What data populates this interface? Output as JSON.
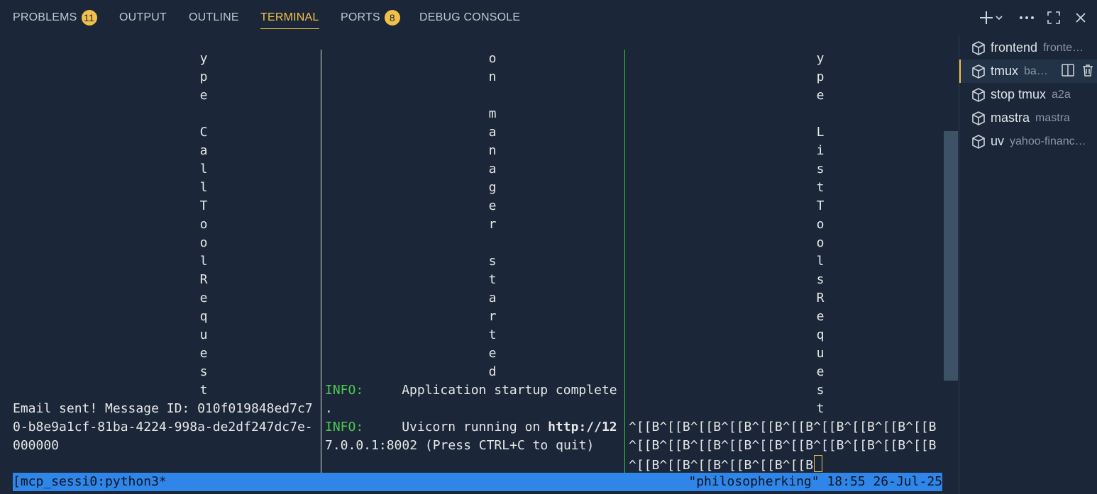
{
  "tabs": [
    {
      "label": "PROBLEMS",
      "badge": "11"
    },
    {
      "label": "OUTPUT"
    },
    {
      "label": "OUTLINE"
    },
    {
      "label": "TERMINAL",
      "active": true
    },
    {
      "label": "PORTS",
      "badge": "8"
    },
    {
      "label": "DEBUG CONSOLE"
    }
  ],
  "header_icons": [
    "new-terminal-icon",
    "chevron-down-icon",
    "more-actions-icon",
    "maximize-icon",
    "close-icon"
  ],
  "terminal": {
    "pane1": {
      "vertical_top": [
        "y",
        "p",
        "e",
        "",
        "C",
        "a",
        "l",
        "l",
        "T",
        "o",
        "o",
        "l",
        "R",
        "e",
        "q",
        "u",
        "e",
        "s",
        "t"
      ],
      "lines": [
        "Email sent! Message ID: 010f019848ed7c7",
        "0-b8e9a1cf-81ba-4224-998a-de2df247dc7e-",
        "000000"
      ]
    },
    "pane2": {
      "vertical_top": [
        "o",
        "n",
        "",
        "m",
        "a",
        "n",
        "a",
        "g",
        "e",
        "r",
        "",
        "s",
        "t",
        "a",
        "r",
        "t",
        "e",
        "d"
      ],
      "info_label": "INFO:",
      "msg1": "Application startup complete",
      "msg1_wrap": ".",
      "msg2_pre": "Uvicorn running on ",
      "msg2_url": "http://12",
      "msg2_wrap": "7.0.0.1:8002 (Press CTRL+C to quit)"
    },
    "pane3": {
      "vertical_top": [
        "y",
        "p",
        "e",
        "",
        "L",
        "i",
        "s",
        "t",
        "T",
        "o",
        "o",
        "l",
        "s",
        "R",
        "e",
        "q",
        "u",
        "e",
        "s",
        "t"
      ],
      "lines": [
        "^[[B^[[B^[[B^[[B^[[B^[[B^[[B^[[B^[[B^[[B",
        "^[[B^[[B^[[B^[[B^[[B^[[B^[[B^[[B^[[B^[[B",
        "^[[B^[[B^[[B^[[B^[[B^[[B"
      ]
    },
    "status_left": "[mcp_sessi0:python3*",
    "status_right": "\"philosopherking\" 18:55 26-Jul-25"
  },
  "sidebar": {
    "items": [
      {
        "name": "frontend",
        "desc": "fronte…"
      },
      {
        "name": "tmux",
        "desc": "ba…",
        "active": true
      },
      {
        "name": "stop tmux",
        "desc": "a2a"
      },
      {
        "name": "mastra",
        "desc": "mastra"
      },
      {
        "name": "uv",
        "desc": "yahoo-financ…"
      }
    ]
  },
  "colors": {
    "accent": "#f2c04a",
    "info": "#4ec94e",
    "status_bg": "#2f86e8",
    "bg": "#1b2739"
  }
}
